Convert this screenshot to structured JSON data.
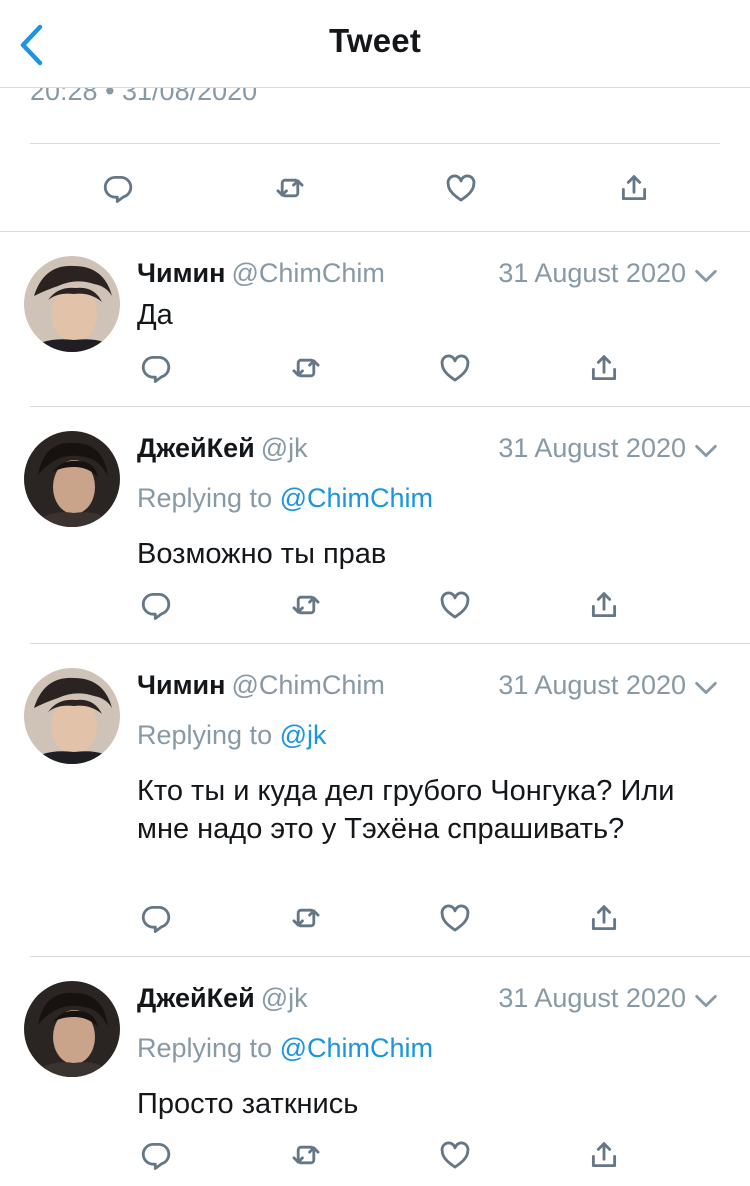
{
  "header": {
    "title": "Tweet",
    "back_icon": "chevron-left-icon"
  },
  "main_tweet": {
    "timestamp": "20:28 • 31/08/2020"
  },
  "colors": {
    "accent": "#1b95e0",
    "muted": "#8899a6",
    "text": "#14171a",
    "icon": "#657786"
  },
  "replies": [
    {
      "name": "Чимин",
      "handle": "@ChimChim",
      "date": "31 August 2020",
      "replying_label": "",
      "replying_to": "",
      "text": "Да"
    },
    {
      "name": "ДжейКей",
      "handle": "@jk",
      "date": "31 August 2020",
      "replying_label": "Replying to",
      "replying_to": "@ChimChim",
      "text": "Возможно ты прав"
    },
    {
      "name": "Чимин",
      "handle": "@ChimChim",
      "date": "31 August 2020",
      "replying_label": "Replying to",
      "replying_to": "@jk",
      "text": "Кто ты и куда дел грубого Чонгука? Или мне надо это у Тэхёна спрашивать?"
    },
    {
      "name": "ДжейКей",
      "handle": "@jk",
      "date": "31 August 2020",
      "replying_label": "Replying to",
      "replying_to": "@ChimChim",
      "text": "Просто заткнись"
    }
  ]
}
